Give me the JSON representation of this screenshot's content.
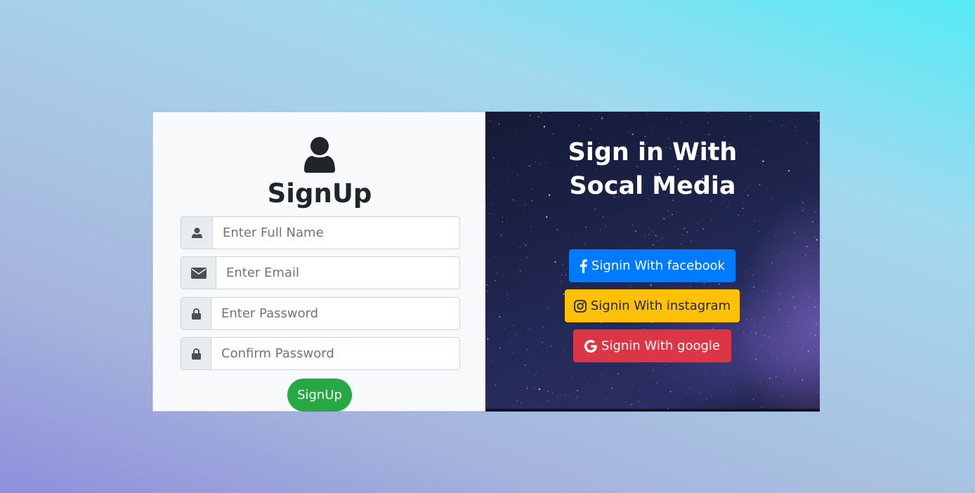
{
  "signup": {
    "title": "SignUp",
    "fields": [
      {
        "icon": "user-icon",
        "placeholder": "Enter Full Name"
      },
      {
        "icon": "envelope-icon",
        "placeholder": "Enter Email"
      },
      {
        "icon": "lock-icon",
        "placeholder": "Enter Password"
      },
      {
        "icon": "lock-icon",
        "placeholder": "Confirm Password"
      }
    ],
    "submit_label": "SignUp"
  },
  "social": {
    "title_line1": "Sign in With",
    "title_line2": "Socal Media",
    "buttons": [
      {
        "icon": "facebook-icon",
        "label": "Signin With facebook",
        "color": "#007bff"
      },
      {
        "icon": "instagram-icon",
        "label": "Signin With instagram",
        "color": "#ffc107"
      },
      {
        "icon": "google-icon",
        "label": "Signin With google",
        "color": "#dc3545"
      }
    ]
  },
  "colors": {
    "success": "#28a745",
    "text_dark": "#212529",
    "input_addon": "#e9ecef"
  }
}
